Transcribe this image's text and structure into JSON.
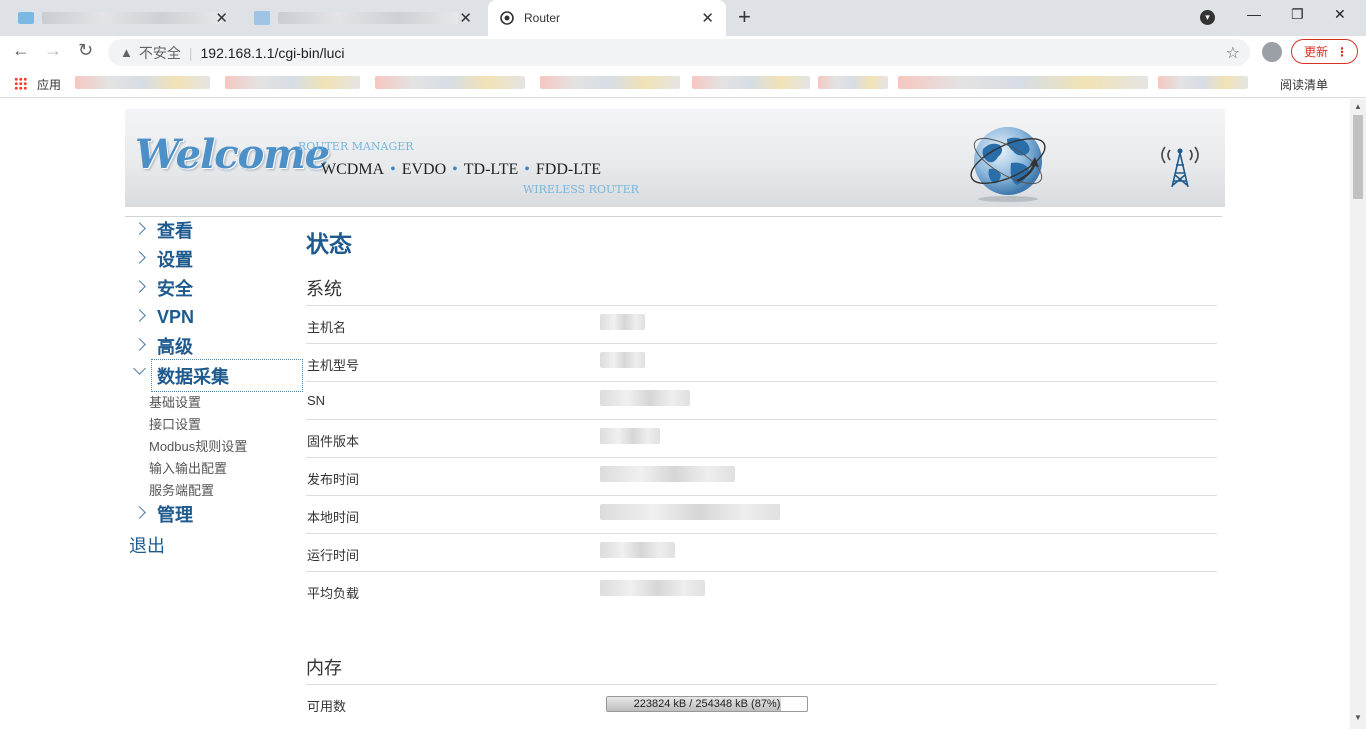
{
  "browser": {
    "active_tab_title": "Router",
    "insecure_label": "不安全",
    "url": "192.168.1.1/cgi-bin/luci",
    "update_label": "更新",
    "bookmarks_apps_label": "应用",
    "reading_list_label": "阅读清单"
  },
  "banner": {
    "welcome": "Welcome",
    "router_manager": "ROUTER MANAGER",
    "modes": [
      "WCDMA",
      "EVDO",
      "TD-LTE",
      "FDD-LTE"
    ],
    "wireless_router": "WIRELESS ROUTER"
  },
  "menu": {
    "items": [
      {
        "label": "查看"
      },
      {
        "label": "设置"
      },
      {
        "label": "安全"
      },
      {
        "label": "VPN"
      },
      {
        "label": "高级"
      },
      {
        "label": "数据采集"
      },
      {
        "label": "管理"
      }
    ],
    "subitems": [
      "基础设置",
      "接口设置",
      "Modbus规则设置",
      "输入输出配置",
      "服务端配置"
    ],
    "logout": "退出"
  },
  "main": {
    "page_title": "状态",
    "system": {
      "title": "系统",
      "rows": [
        "主机名",
        "主机型号",
        "SN",
        "固件版本",
        "发布时间",
        "本地时间",
        "运行时间",
        "平均负载"
      ]
    },
    "memory": {
      "title": "内存",
      "available_label": "可用数",
      "available_text": "223824 kB / 254348 kB (87%)",
      "available_fraction": 0.87
    }
  },
  "colors": {
    "link_blue": "#1e5a8e",
    "update_red": "#d93025"
  }
}
